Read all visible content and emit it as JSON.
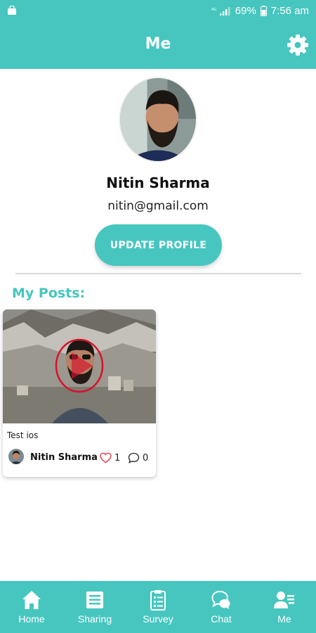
{
  "status_bar": {
    "battery": "69%",
    "time": "7:56 am"
  },
  "header": {
    "title": "Me"
  },
  "profile": {
    "name": "Nitin Sharma",
    "email": "nitin@gmail.com",
    "update_button": "UPDATE PROFILE"
  },
  "posts": {
    "heading": "My Posts:",
    "items": [
      {
        "caption": "Test ios",
        "author": "Nitin Sharma",
        "likes": "1",
        "comments": "0"
      }
    ]
  },
  "nav": {
    "items": [
      {
        "label": "Home",
        "icon": "home-icon"
      },
      {
        "label": "Sharing",
        "icon": "list-icon"
      },
      {
        "label": "Survey",
        "icon": "clipboard-icon"
      },
      {
        "label": "Chat",
        "icon": "chat-icon"
      },
      {
        "label": "Me",
        "icon": "profile-icon"
      }
    ]
  },
  "colors": {
    "primary": "#46c6bf",
    "like": "#e23b4e",
    "play": "#d8112a"
  }
}
